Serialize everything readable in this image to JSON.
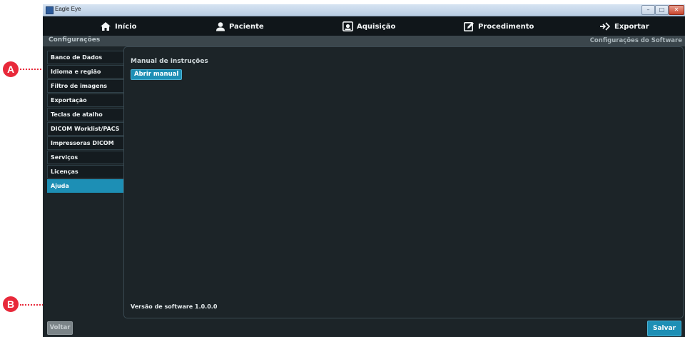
{
  "window": {
    "title": "Eagle Eye",
    "controls": [
      "–",
      "□",
      "✕"
    ]
  },
  "nav": [
    {
      "label": "Início",
      "icon": "home-icon"
    },
    {
      "label": "Paciente",
      "icon": "user-icon"
    },
    {
      "label": "Aquisição",
      "icon": "camera-icon"
    },
    {
      "label": "Procedimento",
      "icon": "edit-icon"
    },
    {
      "label": "Exportar",
      "icon": "export-icon"
    }
  ],
  "subheader": {
    "left": "Configurações",
    "right": "Configurações do Software"
  },
  "sidebar": {
    "items": [
      {
        "label": "Banco de Dados"
      },
      {
        "label": "Idioma e região"
      },
      {
        "label": "Filtro de imagens"
      },
      {
        "label": "Exportação"
      },
      {
        "label": "Teclas de atalho"
      },
      {
        "label": "DICOM Worklist/PACS"
      },
      {
        "label": "Impressoras DICOM"
      },
      {
        "label": "Serviços"
      },
      {
        "label": "Licenças"
      },
      {
        "label": "Ajuda"
      }
    ],
    "active": "Ajuda"
  },
  "panel": {
    "section_title": "Manual de instruções",
    "open_button": "Abrir manual",
    "version": "Versão de software 1.0.0.0"
  },
  "footer": {
    "back_button": "Voltar",
    "save_button": "Salvar"
  },
  "callouts": {
    "a": "A",
    "b": "B"
  },
  "colors": {
    "accent": "#1d8fb5",
    "background": "#1c2428",
    "callout": "#e8293a"
  }
}
